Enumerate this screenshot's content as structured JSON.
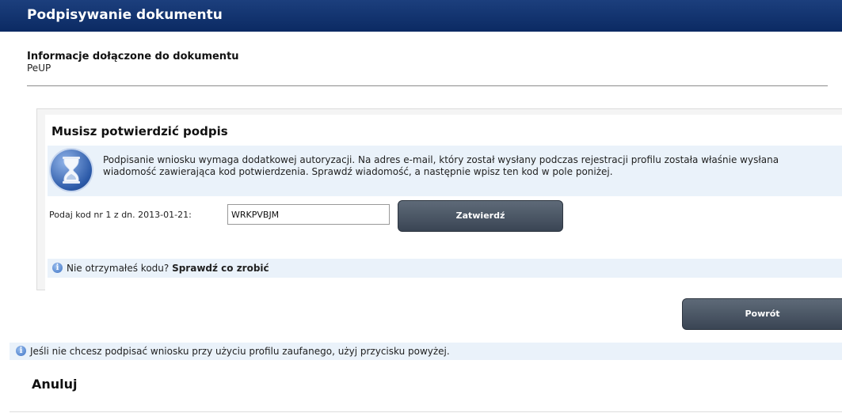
{
  "header": {
    "title": "Podpisywanie dokumentu"
  },
  "document_info": {
    "title": "Informacje dołączone do dokumentu",
    "value": "PeUP"
  },
  "confirm_panel": {
    "title": "Musisz potwierdzić podpis",
    "auth_message": "Podpisanie wniosku wymaga dodatkowej autoryzacji. Na adres e-mail, który został wysłany podczas rejestracji profilu została właśnie wysłana wiadomość zawierająca kod potwierdzenia. Sprawdź wiadomość, a następnie wpisz ten kod w pole poniżej.",
    "code_label": "Podaj kod nr 1 z dn. 2013-01-21:",
    "code_value": "WRKPVBJM",
    "confirm_button": "Zatwierdź",
    "hint_prefix": "Nie otrzymałeś kodu?",
    "hint_link": "Sprawdź co zrobić"
  },
  "back_button": "Powrót",
  "notice": "Jeśli nie chcesz podpisać wniosku przy użyciu profilu zaufanego, użyj przycisku powyżej.",
  "cancel_link": "Anuluj",
  "icons": {
    "hourglass": "hourglass-icon",
    "info": "info-icon"
  }
}
